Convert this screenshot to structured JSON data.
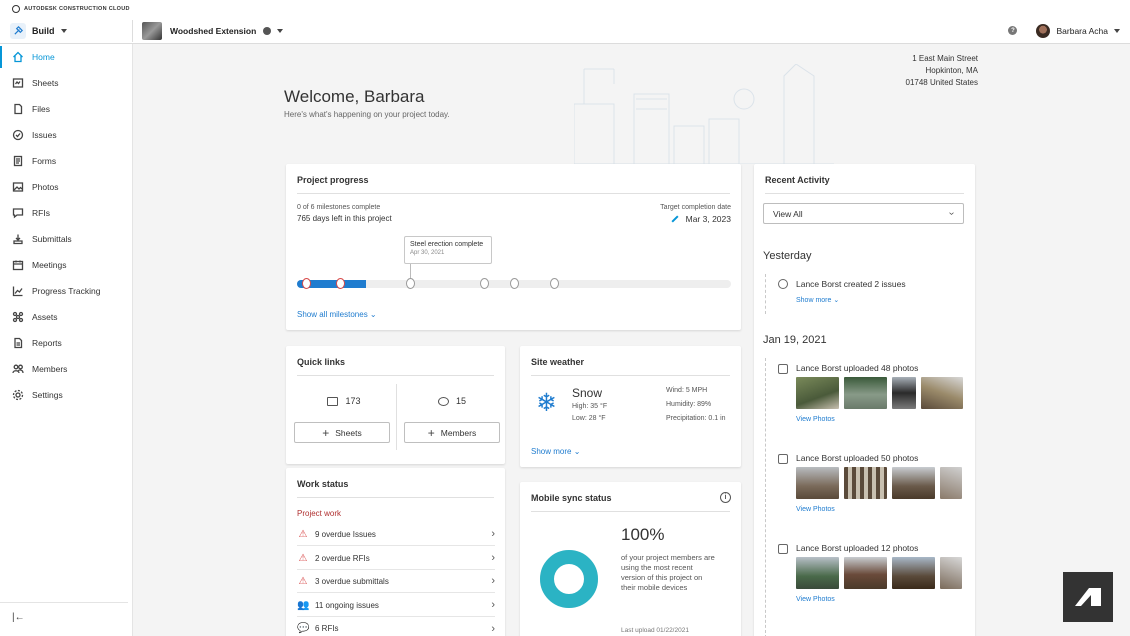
{
  "brand": {
    "text": "AUTODESK CONSTRUCTION CLOUD"
  },
  "topbar": {
    "product": "Build",
    "project": "Woodshed Extension",
    "user": "Barbara Acha"
  },
  "sidebar": {
    "items": [
      {
        "label": "Home",
        "icon": "home-icon"
      },
      {
        "label": "Sheets",
        "icon": "sheets-icon"
      },
      {
        "label": "Files",
        "icon": "files-icon"
      },
      {
        "label": "Issues",
        "icon": "issues-icon"
      },
      {
        "label": "Forms",
        "icon": "forms-icon"
      },
      {
        "label": "Photos",
        "icon": "photos-icon"
      },
      {
        "label": "RFIs",
        "icon": "rfis-icon"
      },
      {
        "label": "Submittals",
        "icon": "submittals-icon"
      },
      {
        "label": "Meetings",
        "icon": "meetings-icon"
      },
      {
        "label": "Progress Tracking",
        "icon": "progress-tracking-icon"
      },
      {
        "label": "Assets",
        "icon": "assets-icon"
      },
      {
        "label": "Reports",
        "icon": "reports-icon"
      },
      {
        "label": "Members",
        "icon": "members-icon"
      },
      {
        "label": "Settings",
        "icon": "settings-icon"
      }
    ],
    "active_index": 0
  },
  "address": {
    "line1": "1 East Main Street",
    "line2": "Hopkinton, MA",
    "line3": "01748 United States"
  },
  "welcome": {
    "title": "Welcome, Barbara",
    "subtitle": "Here's what's happening on your project today."
  },
  "project_progress": {
    "title": "Project progress",
    "milestones": "0 of 6 milestones complete",
    "days_left": "765 days left in this project",
    "target_label": "Target completion date",
    "target_date": "Mar 3, 2023",
    "tooltip_title": "Steel erection complete",
    "tooltip_date": "Apr 30, 2021",
    "progress_fraction": 0.16,
    "show_all": "Show all milestones"
  },
  "quick_links": {
    "title": "Quick links",
    "sheets_count": "173",
    "members_count": "15",
    "sheets_btn": "Sheets",
    "members_btn": "Members"
  },
  "site_weather": {
    "title": "Site weather",
    "condition": "Snow",
    "high": "High: 35 °F",
    "low": "Low: 28 °F",
    "wind": "Wind: 5 MPH",
    "humidity": "Humidity: 89%",
    "precip": "Precipitation: 0.1 in",
    "show_more": "Show more"
  },
  "work_status": {
    "title": "Work status",
    "subtitle": "Project work",
    "rows": [
      {
        "text": "9 overdue Issues",
        "kind": "warn"
      },
      {
        "text": "2 overdue RFIs",
        "kind": "warn"
      },
      {
        "text": "3 overdue submittals",
        "kind": "warn"
      },
      {
        "text": "11 ongoing issues",
        "kind": "people"
      },
      {
        "text": "6 RFIs",
        "kind": "chat"
      }
    ]
  },
  "mobile_sync": {
    "title": "Mobile sync status",
    "percent": "100%",
    "description": "of your project members are using the most recent version of this project on their mobile devices",
    "last_upload": "Last upload 01/22/2021",
    "fraction": 1.0
  },
  "recent_activity": {
    "title": "Recent Activity",
    "filter": "View All",
    "group1": "Yesterday",
    "entry1": "Lance Borst created 2 issues",
    "entry1_link": "Show more",
    "group2": "Jan 19, 2021",
    "entry2": "Lance Borst uploaded 48 photos",
    "entry3": "Lance Borst uploaded 50 photos",
    "entry4": "Lance Borst uploaded 12 photos",
    "view_photos": "View Photos"
  },
  "colors": {
    "accent": "#0696d7",
    "progress": "#1f7ccf",
    "warn": "#d84b4b",
    "donut": "#2bb3c4"
  }
}
